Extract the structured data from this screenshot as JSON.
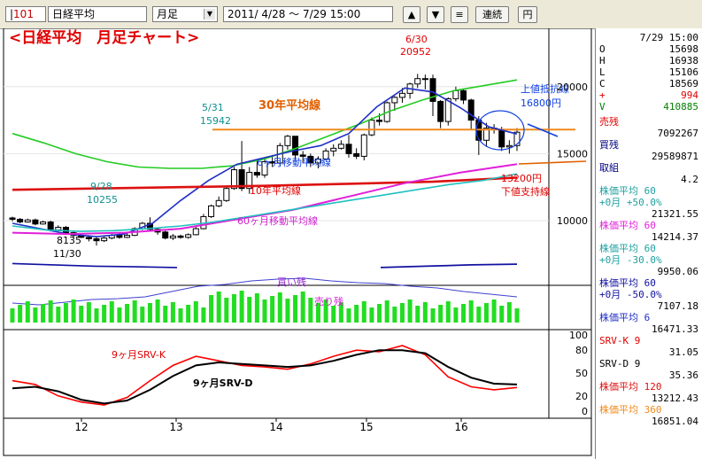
{
  "toolbar": {
    "code_prefix": "|",
    "code": "101",
    "name": "日経平均",
    "period": "月足",
    "range": "2011/ 4/28 ～  7/29 15:00",
    "btn_up": "▲",
    "btn_down": "▼",
    "btn_menu": "≡",
    "btn_continuous": "連続",
    "btn_yen": "円"
  },
  "colors": {
    "candle_up": "#000000",
    "candle_down": "#000000",
    "ma_blue": "#1f2fc6",
    "ma_orange": "#f08a1a",
    "ma_green": "#22cc22",
    "ma_red": "#dd1111",
    "ma_magenta": "#e020d8",
    "ma_cyan": "#20c0c0",
    "ma_navy": "#1010a0",
    "annot_red": "#e00000",
    "annot_orange": "#e06000",
    "annot_blue": "#1040e0",
    "annot_cyan": "#109090",
    "annot_magenta": "#d020d0",
    "volume_green": "#22dd22",
    "srv_k": "#ff0000",
    "srv_d": "#000000"
  },
  "panel": {
    "header": "7/29 15:00",
    "ohlc": [
      {
        "label": "O",
        "value": "15698"
      },
      {
        "label": "H",
        "value": "16938"
      },
      {
        "label": "L",
        "value": "15106"
      },
      {
        "label": "C",
        "value": "18569"
      },
      {
        "label": "+",
        "value": "994"
      },
      {
        "label": "V",
        "value": "410885"
      }
    ],
    "rows": [
      {
        "label": "売残",
        "value": "",
        "color": "#e00000"
      },
      {
        "label": "",
        "value": "7092267",
        "color": "#000000"
      },
      {
        "label": "買残",
        "value": "",
        "color": "#000080"
      },
      {
        "label": "",
        "value": "29589871",
        "color": "#000000"
      },
      {
        "label": "取組",
        "value": "",
        "color": "#000080"
      },
      {
        "label": "",
        "value": "4.2",
        "color": "#000000"
      },
      {
        "label": "株価平均  60",
        "value": "",
        "color": "#20a0a0"
      },
      {
        "label": "+0月 +50.0%",
        "value": "",
        "color": "#20a0a0"
      },
      {
        "label": "",
        "value": "21321.55",
        "color": "#000000"
      },
      {
        "label": "株価平均  60",
        "value": "",
        "color": "#e020d8"
      },
      {
        "label": "",
        "value": "14214.37",
        "color": "#000000"
      },
      {
        "label": "株価平均  60",
        "value": "",
        "color": "#20a0a0"
      },
      {
        "label": "+0月 -30.0%",
        "value": "",
        "color": "#20a0a0"
      },
      {
        "label": "",
        "value": "9950.06",
        "color": "#000000"
      },
      {
        "label": "株価平均  60",
        "value": "",
        "color": "#1010a0"
      },
      {
        "label": "+0月 -50.0%",
        "value": "",
        "color": "#1010a0"
      },
      {
        "label": "",
        "value": "7107.18",
        "color": "#000000"
      },
      {
        "label": "株価平均   6",
        "value": "",
        "color": "#1f2fc6"
      },
      {
        "label": "",
        "value": "16471.33",
        "color": "#000000"
      },
      {
        "label": "SRV-K     9",
        "value": "",
        "color": "#e00000"
      },
      {
        "label": "",
        "value": "31.05",
        "color": "#000000"
      },
      {
        "label": "SRV-D     9",
        "value": "",
        "color": "#000000"
      },
      {
        "label": "",
        "value": "35.36",
        "color": "#000000"
      },
      {
        "label": "株価平均 120",
        "value": "",
        "color": "#dd1111"
      },
      {
        "label": "",
        "value": "13212.43",
        "color": "#000000"
      },
      {
        "label": "株価平均 360",
        "value": "",
        "color": "#f08a1a"
      },
      {
        "label": "",
        "value": "16851.04",
        "color": "#000000"
      }
    ]
  },
  "chart_data": {
    "type": "candlestick",
    "title": "<日経平均　月足チャート>",
    "x_axis_ticks": [
      "12",
      "13",
      "14",
      "15",
      "16"
    ],
    "y_axis_ticks": [
      "20000",
      "15000",
      "10000"
    ],
    "sub_axis_ticks": [
      "100",
      "80",
      "50",
      "20",
      "0"
    ],
    "price_range": [
      5700,
      22500
    ],
    "candles_note": "monthly candles, approx. 1999-2016",
    "candles": [
      [
        10200,
        10100,
        10300,
        9950
      ],
      [
        10100,
        9900,
        10200,
        9800
      ],
      [
        9900,
        10050,
        10150,
        9850
      ],
      [
        10050,
        9750,
        10150,
        9650
      ],
      [
        9750,
        9900,
        10000,
        9700
      ],
      [
        9900,
        9300,
        10000,
        9200
      ],
      [
        9300,
        9500,
        9650,
        9250
      ],
      [
        9500,
        9100,
        9600,
        9000
      ],
      [
        9100,
        8900,
        9200,
        8750
      ],
      [
        8900,
        8750,
        9050,
        8700
      ],
      [
        8750,
        8650,
        8850,
        8450
      ],
      [
        8650,
        8500,
        8800,
        8135
      ],
      [
        8500,
        8700,
        8800,
        8400
      ],
      [
        8700,
        8900,
        9000,
        8600
      ],
      [
        8900,
        8750,
        9050,
        8650
      ],
      [
        8750,
        8900,
        9100,
        8700
      ],
      [
        8900,
        9400,
        9500,
        8850
      ],
      [
        9400,
        9800,
        9900,
        9300
      ],
      [
        9800,
        9350,
        10250,
        9250
      ],
      [
        9350,
        9150,
        9500,
        8950
      ],
      [
        9150,
        8700,
        9250,
        8600
      ],
      [
        8700,
        8850,
        9000,
        8550
      ],
      [
        8850,
        8750,
        8950,
        8650
      ],
      [
        8750,
        8950,
        9050,
        8650
      ],
      [
        8950,
        9400,
        9600,
        8900
      ],
      [
        9400,
        10300,
        10500,
        9350
      ],
      [
        10300,
        11100,
        11200,
        10200
      ],
      [
        11100,
        11500,
        11800,
        11000
      ],
      [
        11500,
        12400,
        12600,
        11400
      ],
      [
        12400,
        13800,
        14000,
        12300
      ],
      [
        13800,
        12400,
        15942,
        12200
      ],
      [
        12400,
        13600,
        14000,
        12000
      ],
      [
        13600,
        13400,
        14500,
        13200
      ],
      [
        13400,
        14400,
        14700,
        13200
      ],
      [
        14400,
        14300,
        14900,
        14000
      ],
      [
        14300,
        15600,
        15800,
        14100
      ],
      [
        15600,
        16300,
        16400,
        15300
      ],
      [
        16300,
        14900,
        16300,
        14500
      ],
      [
        14900,
        14800,
        15200,
        14300
      ],
      [
        14800,
        14300,
        15000,
        14000
      ],
      [
        14300,
        14600,
        14800,
        13900
      ],
      [
        14600,
        15200,
        15400,
        14500
      ],
      [
        15200,
        15400,
        15700,
        14800
      ],
      [
        15400,
        15700,
        16000,
        15300
      ],
      [
        15700,
        15000,
        16400,
        14700
      ],
      [
        15000,
        14800,
        15400,
        14600
      ],
      [
        14800,
        16400,
        16500,
        14500
      ],
      [
        16400,
        17500,
        17700,
        16300
      ],
      [
        17500,
        17400,
        18000,
        17100
      ],
      [
        17400,
        18800,
        18900,
        17300
      ],
      [
        18800,
        19200,
        19300,
        18200
      ],
      [
        19200,
        19500,
        19900,
        18800
      ],
      [
        19500,
        20200,
        20300,
        19100
      ],
      [
        20200,
        20600,
        20952,
        19900
      ],
      [
        20600,
        20600,
        20900,
        19800
      ],
      [
        20600,
        18900,
        20900,
        17800
      ],
      [
        18900,
        17400,
        19000,
        16900
      ],
      [
        17400,
        19100,
        19200,
        17100
      ],
      [
        19100,
        19700,
        20000,
        18900
      ],
      [
        19700,
        19000,
        19800,
        18700
      ],
      [
        19000,
        17500,
        19100,
        16800
      ],
      [
        17500,
        16000,
        17800,
        14900
      ],
      [
        16000,
        16900,
        17300,
        15500
      ],
      [
        16900,
        16800,
        17200,
        16500
      ],
      [
        16800,
        15500,
        17000,
        15200
      ],
      [
        15500,
        15600,
        16000,
        15000
      ],
      [
        15600,
        16600,
        16900,
        15200
      ]
    ],
    "series": [
      {
        "name": "30年平均線",
        "values": [
          16800
        ]
      },
      {
        "name": "6ヶ月移動平均線",
        "values": [
          9800,
          9400,
          9000,
          8800,
          9000,
          9800,
          11500,
          13000,
          14200,
          14700,
          15200,
          15600,
          16500,
          18500,
          19900,
          19600,
          18400,
          17000,
          16471
        ]
      },
      {
        "name": "10年平均線",
        "values": [
          12300,
          12400,
          12500,
          12600,
          12750,
          12900,
          13212
        ]
      },
      {
        "name": "60ヶ月移動平均線",
        "values": [
          9100,
          9000,
          9100,
          9400,
          10100,
          10800,
          11800,
          12800,
          13600,
          14214
        ]
      },
      {
        "name": "9ヶ月SRV-K",
        "values": [
          40,
          35,
          20,
          12,
          8,
          18,
          40,
          60,
          72,
          66,
          60,
          58,
          55,
          62,
          72,
          80,
          78,
          86,
          74,
          45,
          32,
          28,
          31
        ]
      },
      {
        "name": "9ヶ月SRV-D",
        "values": [
          30,
          32,
          26,
          15,
          10,
          14,
          28,
          46,
          60,
          64,
          62,
          60,
          58,
          60,
          66,
          74,
          80,
          80,
          76,
          58,
          44,
          36,
          35
        ]
      }
    ],
    "annotations": [
      {
        "text": "<日経平均　月足チャート>",
        "color": "#e00000"
      },
      {
        "text": "30年平均線",
        "color": "#e06000"
      },
      {
        "text": "上値抵抗線",
        "color": "#1040e0"
      },
      {
        "text": "16800円",
        "color": "#1040e0"
      },
      {
        "text": "6ヶ月移動平均線",
        "color": "#1040e0"
      },
      {
        "text": "10年平均線",
        "color": "#e00000"
      },
      {
        "text": "13200円",
        "color": "#e00000"
      },
      {
        "text": "下値支持線",
        "color": "#e00000"
      },
      {
        "text": "60ヶ月移動平均線",
        "color": "#d020d0"
      },
      {
        "text": "5/31",
        "color": "#109090"
      },
      {
        "text": "15942",
        "color": "#109090"
      },
      {
        "text": "6/30",
        "color": "#e00000"
      },
      {
        "text": "20952",
        "color": "#e00000"
      },
      {
        "text": "9/28",
        "color": "#109090"
      },
      {
        "text": "10255",
        "color": "#109090"
      },
      {
        "text": "8135",
        "color": "#000000"
      },
      {
        "text": "11/30",
        "color": "#000000"
      },
      {
        "text": "買い残",
        "color": "#9020d0"
      },
      {
        "text": "売り残",
        "color": "#d020d0"
      },
      {
        "text": "9ヶ月SRV-K",
        "color": "#e00000"
      },
      {
        "text": "9ヶ月SRV-D",
        "color": "#000000"
      }
    ]
  }
}
